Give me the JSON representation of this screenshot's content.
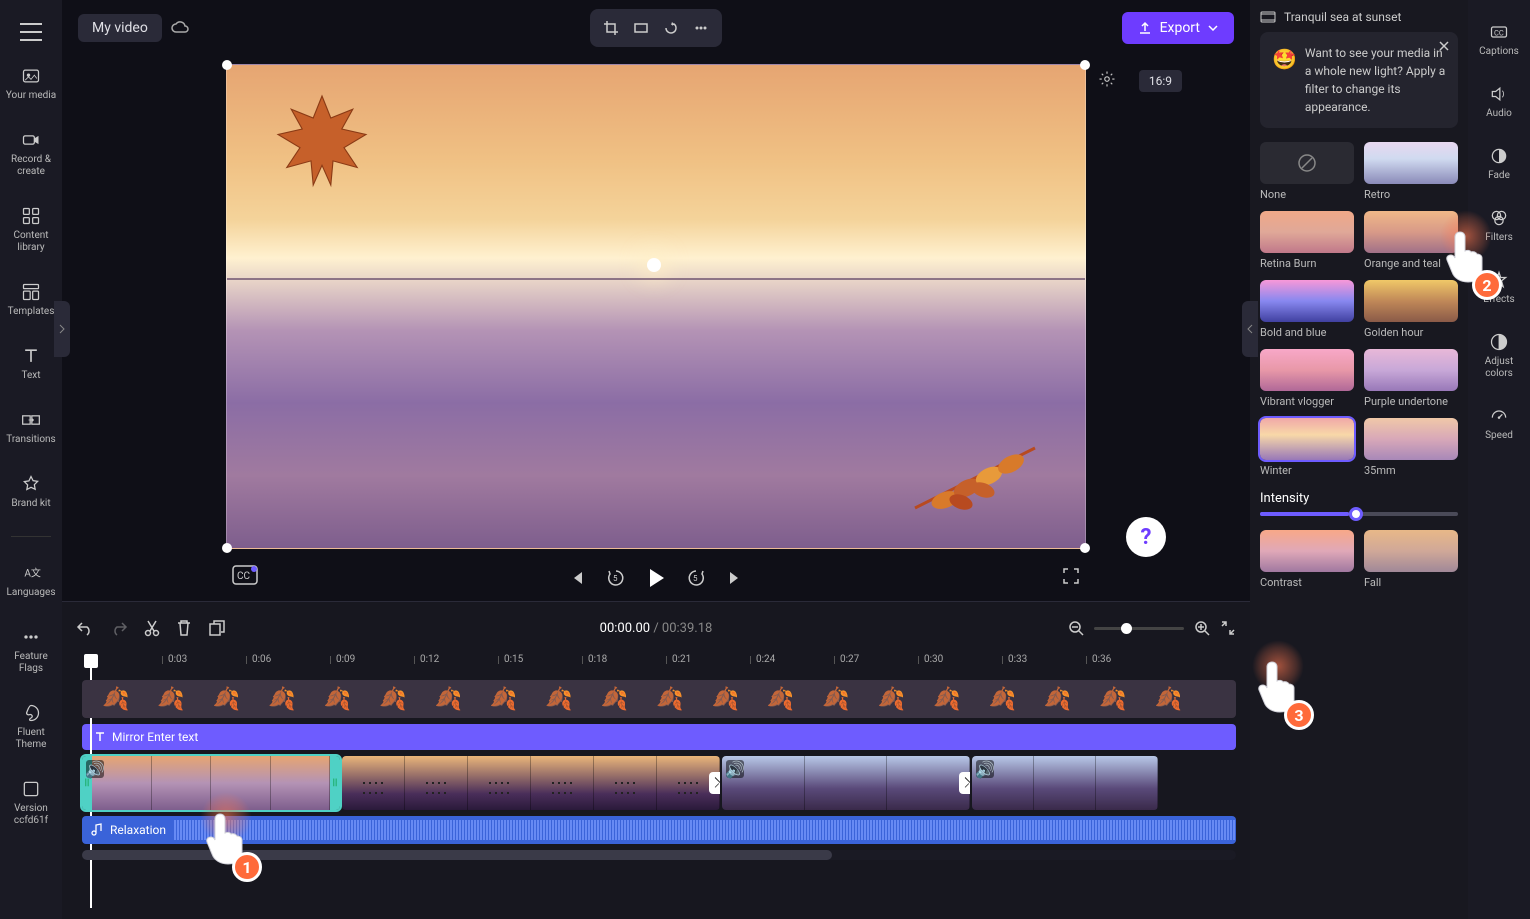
{
  "topbar": {
    "project_title": "My video",
    "export_label": "Export",
    "aspect_ratio": "16:9"
  },
  "left_sidebar": {
    "your_media": "Your media",
    "record_create": "Record & create",
    "content_library": "Content library",
    "templates": "Templates",
    "text": "Text",
    "transitions": "Transitions",
    "brand_kit": "Brand kit",
    "languages": "Languages",
    "feature_flags": "Feature Flags",
    "fluent_theme": "Fluent Theme",
    "version": "Version ccfd61f"
  },
  "playback": {
    "current": "00:00.00",
    "total": "00:39.18"
  },
  "timeline": {
    "ticks": [
      "0:03",
      "0:06",
      "0:09",
      "0:12",
      "0:15",
      "0:18",
      "0:21",
      "0:24",
      "0:27",
      "0:30",
      "0:33",
      "0:36"
    ],
    "text_clip": "Mirror Enter text",
    "audio_clip": "Relaxation"
  },
  "right_panel": {
    "clip_name": "Tranquil sea at sunset",
    "tip_text": "Want to see your media in a whole new light? Apply a filter to change its appearance.",
    "intensity_label": "Intensity",
    "filters": {
      "none": "None",
      "retro": "Retro",
      "retina_burn": "Retina Burn",
      "orange_teal": "Orange and teal",
      "bold_blue": "Bold and blue",
      "golden_hour": "Golden hour",
      "vibrant_vlogger": "Vibrant vlogger",
      "purple_undertone": "Purple undertone",
      "winter": "Winter",
      "mm35": "35mm",
      "contrast": "Contrast",
      "fall": "Fall"
    }
  },
  "prop_sidebar": {
    "captions": "Captions",
    "audio": "Audio",
    "fade": "Fade",
    "filters": "Filters",
    "effects": "Effects",
    "adjust_colors": "Adjust colors",
    "speed": "Speed"
  },
  "annotations": {
    "n1": "1",
    "n2": "2",
    "n3": "3"
  },
  "help": "?"
}
